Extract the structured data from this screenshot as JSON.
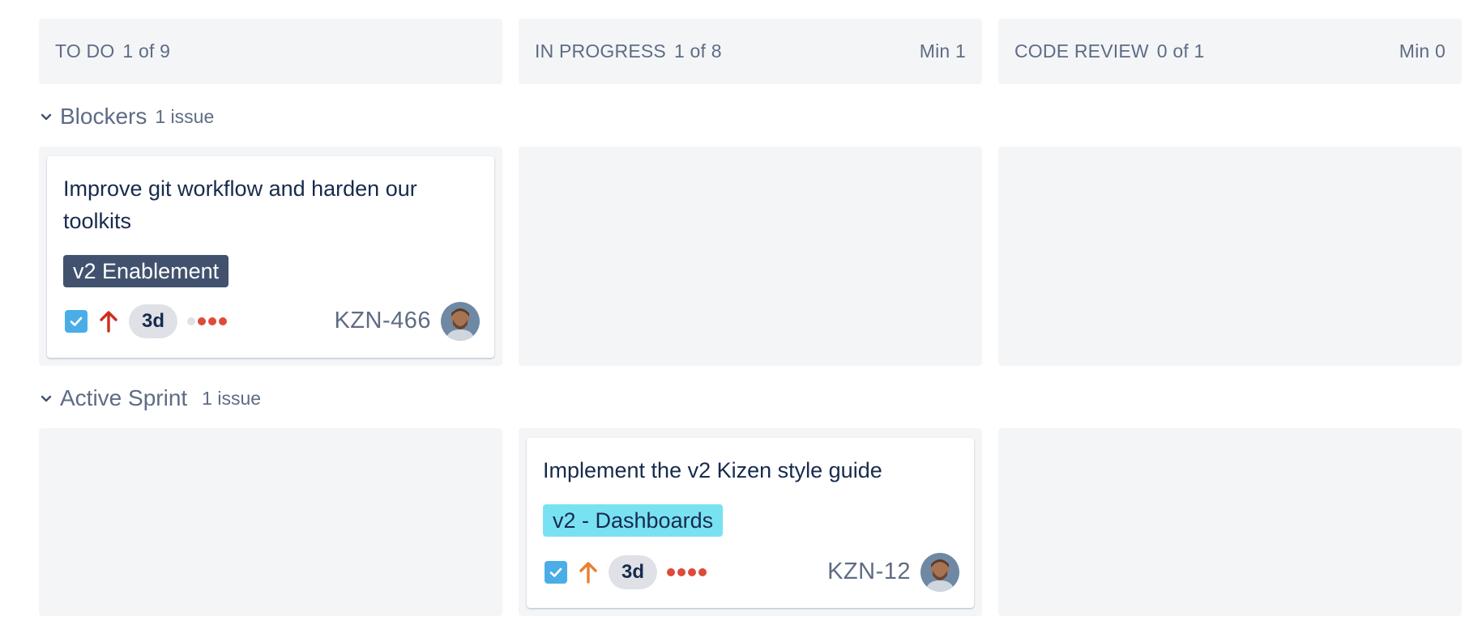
{
  "columns": [
    {
      "name": "TO DO",
      "count": "1 of 9",
      "min": ""
    },
    {
      "name": "IN PROGRESS",
      "count": "1 of 8",
      "min": "Min 1"
    },
    {
      "name": "CODE REVIEW",
      "count": "0 of 1",
      "min": "Min 0"
    }
  ],
  "swimlanes": [
    {
      "title": "Blockers",
      "count": "1 issue",
      "card": {
        "column": "TO DO",
        "summary_line1": "Improve git workflow and harden our",
        "summary_line2": "toolkits",
        "epic": "v2 Enablement",
        "epic_bg": "#42526e",
        "epic_color": "#ffffff",
        "priority_icon": "arrow-up-icon",
        "priority_color": "#cd2f1d",
        "estimate": "3d",
        "key": "KZN-466",
        "done_checked": true
      }
    },
    {
      "title": "Active Sprint",
      "count": "1 issue",
      "card": {
        "column": "IN PROGRESS",
        "summary_line1": "Implement the v2 Kizen style guide",
        "epic": "v2 - Dashboards",
        "epic_bg": "#79e2f2",
        "epic_color": "#172b4d",
        "priority_icon": "arrow-up-icon",
        "priority_color": "#e97f33",
        "estimate": "3d",
        "key": "KZN-12",
        "done_checked": true
      }
    }
  ],
  "colors": {
    "column_bg": "#f4f5f7",
    "muted_text": "#5e6c84",
    "checkbox": "#4bade8",
    "estimate_bg": "#dfe1e6",
    "dot_red": "#de4a3b",
    "dot_grey": "#dfe1e6"
  }
}
